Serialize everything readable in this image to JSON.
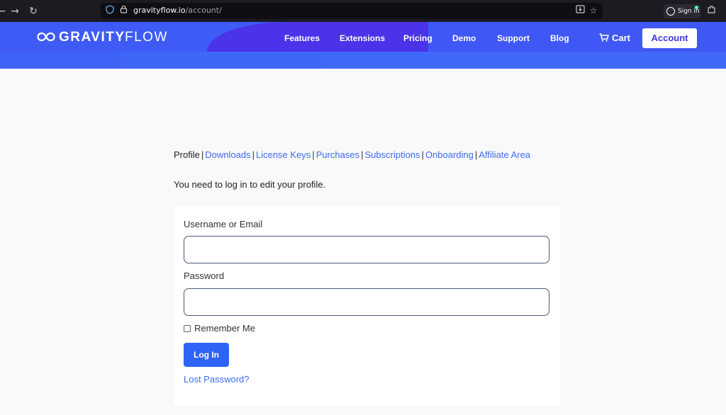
{
  "browser": {
    "url_domain": "gravityflow.io",
    "url_path": "/account/",
    "signin_label": "Sign in",
    "icons": [
      "back-icon",
      "forward-icon",
      "reload-icon",
      "shield-icon",
      "lock-icon",
      "reader-view-icon",
      "star-icon",
      "account-icon",
      "extensions-icon"
    ]
  },
  "header": {
    "logo_bold": "GRAVITY",
    "logo_light": "FLOW",
    "nav": [
      {
        "label": "Features"
      },
      {
        "label": "Extensions"
      },
      {
        "label": "Pricing"
      },
      {
        "label": "Demo"
      },
      {
        "label": "Support"
      },
      {
        "label": "Blog"
      }
    ],
    "cart_label": "Cart",
    "account_label": "Account",
    "colors": {
      "primary": "#3e5bf5",
      "accent": "#4a33e8",
      "button": "#2f63f6"
    }
  },
  "account_tabs": {
    "current": "Profile",
    "links": [
      "Downloads",
      "License Keys",
      "Purchases",
      "Subscriptions",
      "Onboarding",
      "Affiliate Area"
    ]
  },
  "notice": "You need to log in to edit your profile.",
  "login_form": {
    "username_label": "Username or Email",
    "username_value": "",
    "password_label": "Password",
    "password_value": "",
    "remember_label": "Remember Me",
    "remember_checked": false,
    "submit_label": "Log In",
    "lost_password_label": "Lost Password?"
  }
}
